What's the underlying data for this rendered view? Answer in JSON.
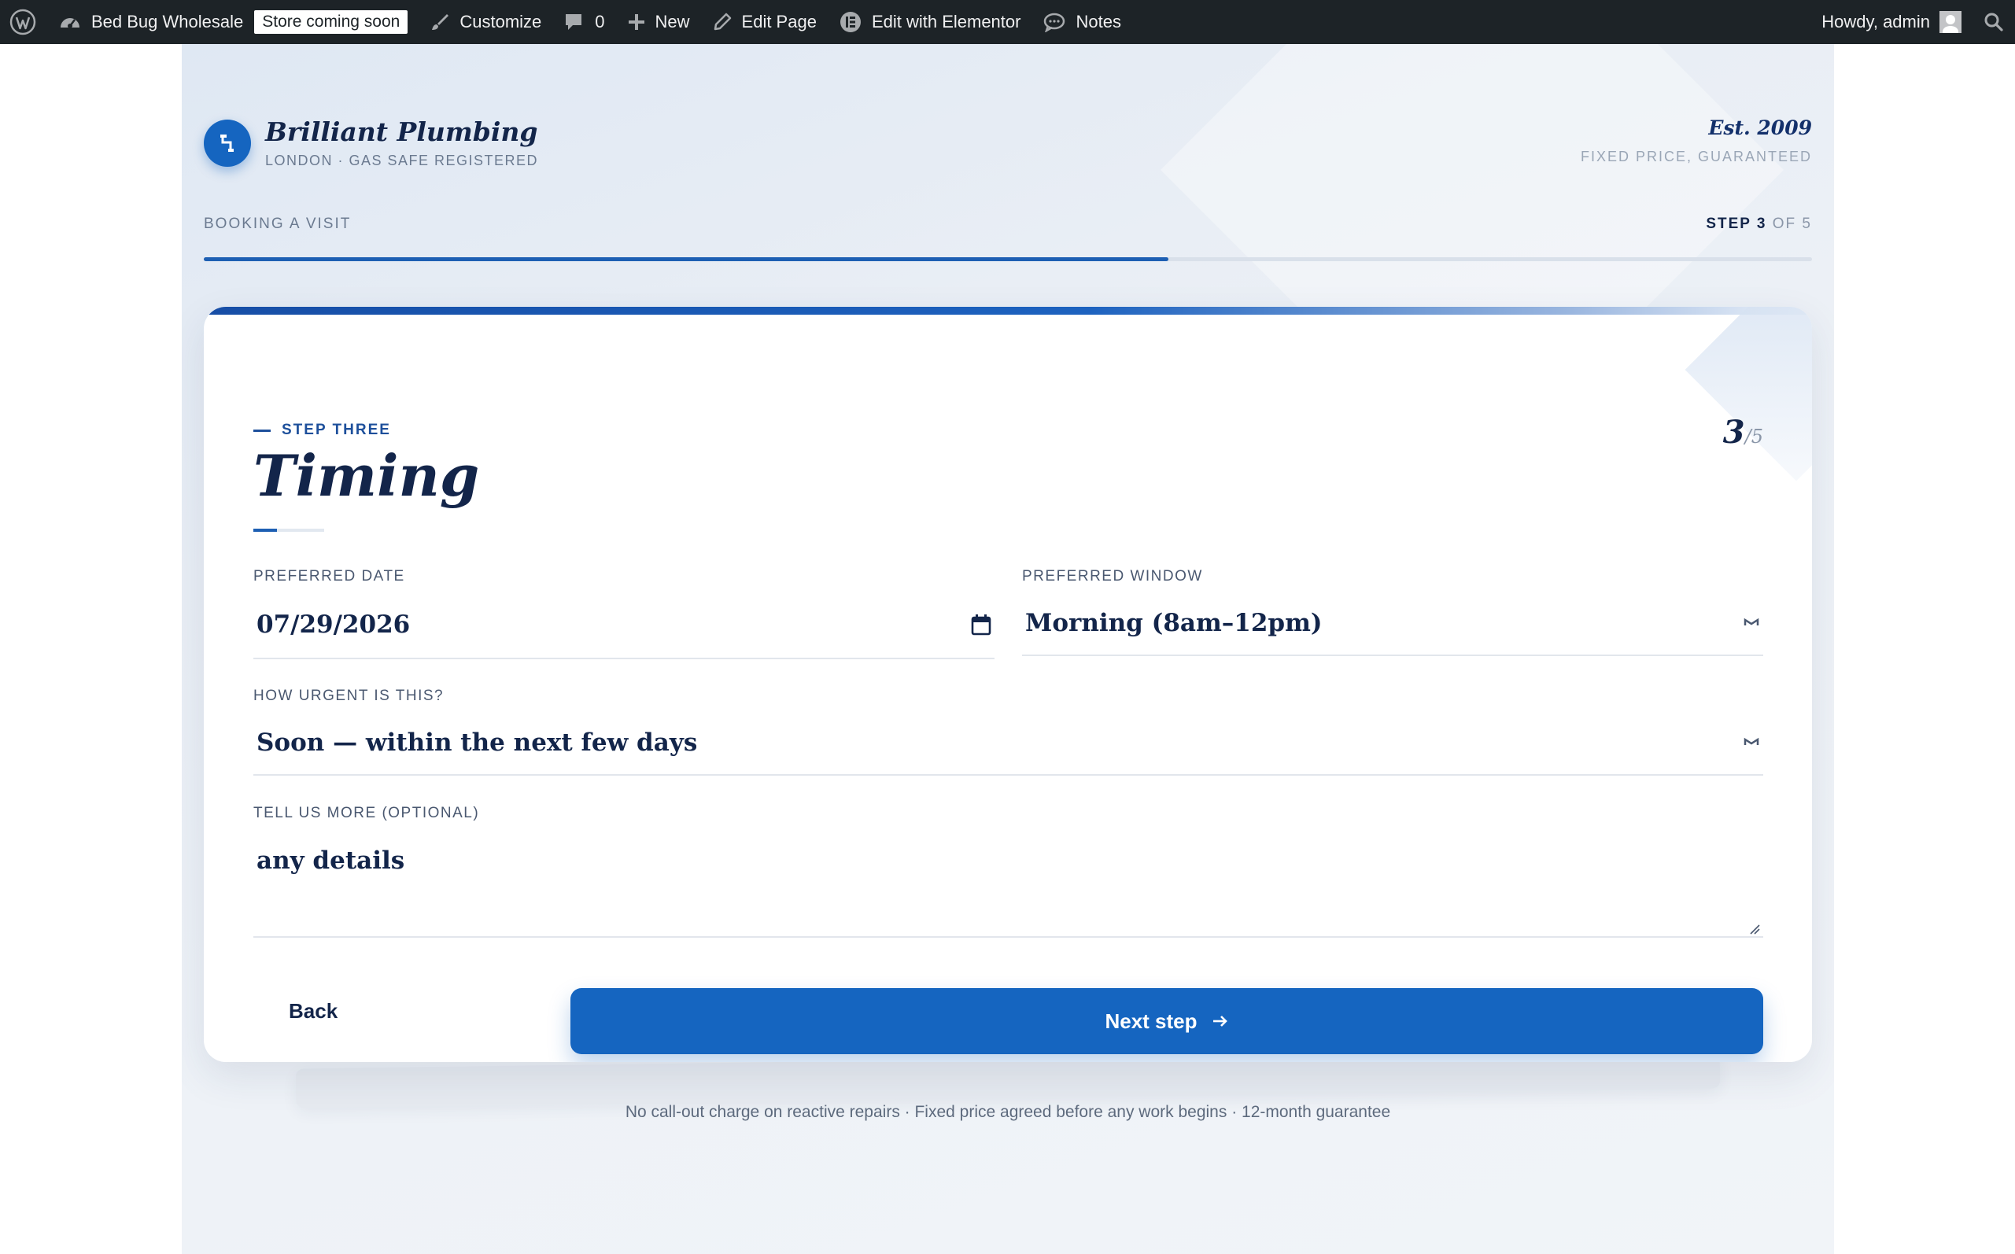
{
  "admin_bar": {
    "site_name": "Bed Bug Wholesale",
    "store_badge": "Store coming soon",
    "customize": "Customize",
    "comments_count": "0",
    "new": "New",
    "edit_page": "Edit Page",
    "edit_elementor": "Edit with Elementor",
    "notes": "Notes",
    "howdy": "Howdy, admin"
  },
  "brand": {
    "name": "Brilliant Plumbing",
    "subtitle": "LONDON · GAS SAFE REGISTERED",
    "est": "Est. 2009",
    "tagline": "FIXED PRICE, GUARANTEED"
  },
  "progress": {
    "section_label": "BOOKING A VISIT",
    "step_word": "STEP",
    "current_step": "3",
    "of_total": "OF 5",
    "fraction": 0.6
  },
  "step": {
    "eyebrow": "STEP THREE",
    "title": "Timing",
    "number": "3",
    "total": "/5"
  },
  "form": {
    "date_label": "PREFERRED DATE",
    "date_value": "07/29/2026",
    "window_label": "PREFERRED WINDOW",
    "window_value": "Morning (8am–12pm)",
    "urgency_label": "HOW URGENT IS THIS?",
    "urgency_value": "Soon — within the next few days",
    "details_label": "TELL US MORE (OPTIONAL)",
    "details_value": "any details"
  },
  "actions": {
    "back": "Back",
    "next": "Next step"
  },
  "footer_note": "No call-out charge on reactive repairs · Fixed price agreed before any work begins · 12-month guarantee",
  "colors": {
    "accent": "#1565c0",
    "navy": "#13254a",
    "admin_bar": "#1d2327"
  }
}
